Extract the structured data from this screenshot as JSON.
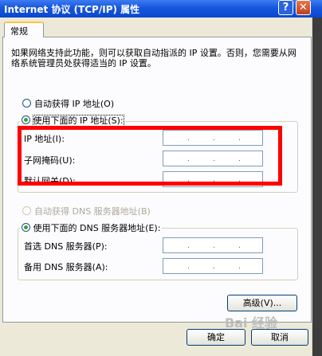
{
  "window": {
    "title": "Internet 协议 (TCP/IP) 属性",
    "help_label": "?",
    "close_label": "✕"
  },
  "tabs": [
    {
      "label": "常规"
    }
  ],
  "description": "如果网络支持此功能，则可以获取自动指派的 IP 设置。否则，您需要从网络系统管理员处获得适当的 IP 设置。",
  "ip_section": {
    "auto_label": "自动获得 IP 地址(O)",
    "manual_label": "使用下面的 IP 地址(S):",
    "selected": "manual",
    "fields": [
      {
        "label": "IP 地址(I):",
        "value": ""
      },
      {
        "label": "子网掩码(U):",
        "value": ""
      },
      {
        "label": "默认网关(D):",
        "value": ""
      }
    ]
  },
  "dns_section": {
    "auto_label": "自动获得 DNS 服务器地址(B)",
    "manual_label": "使用下面的 DNS 服务器地址(E):",
    "selected": "manual",
    "fields": [
      {
        "label": "首选 DNS 服务器(P):",
        "value": ""
      },
      {
        "label": "备用 DNS 服务器(A):",
        "value": ""
      }
    ]
  },
  "buttons": {
    "advanced": "高级(V)...",
    "ok": "确定",
    "cancel": "取消"
  },
  "watermark": "Bai 经验",
  "colors": {
    "titlebar": "#0a47cf",
    "dialog_bg": "#ece9d8",
    "panel_bg": "#fcfcfe",
    "highlight_box": "#ff0000",
    "tab_accent": "#ffc83c"
  }
}
